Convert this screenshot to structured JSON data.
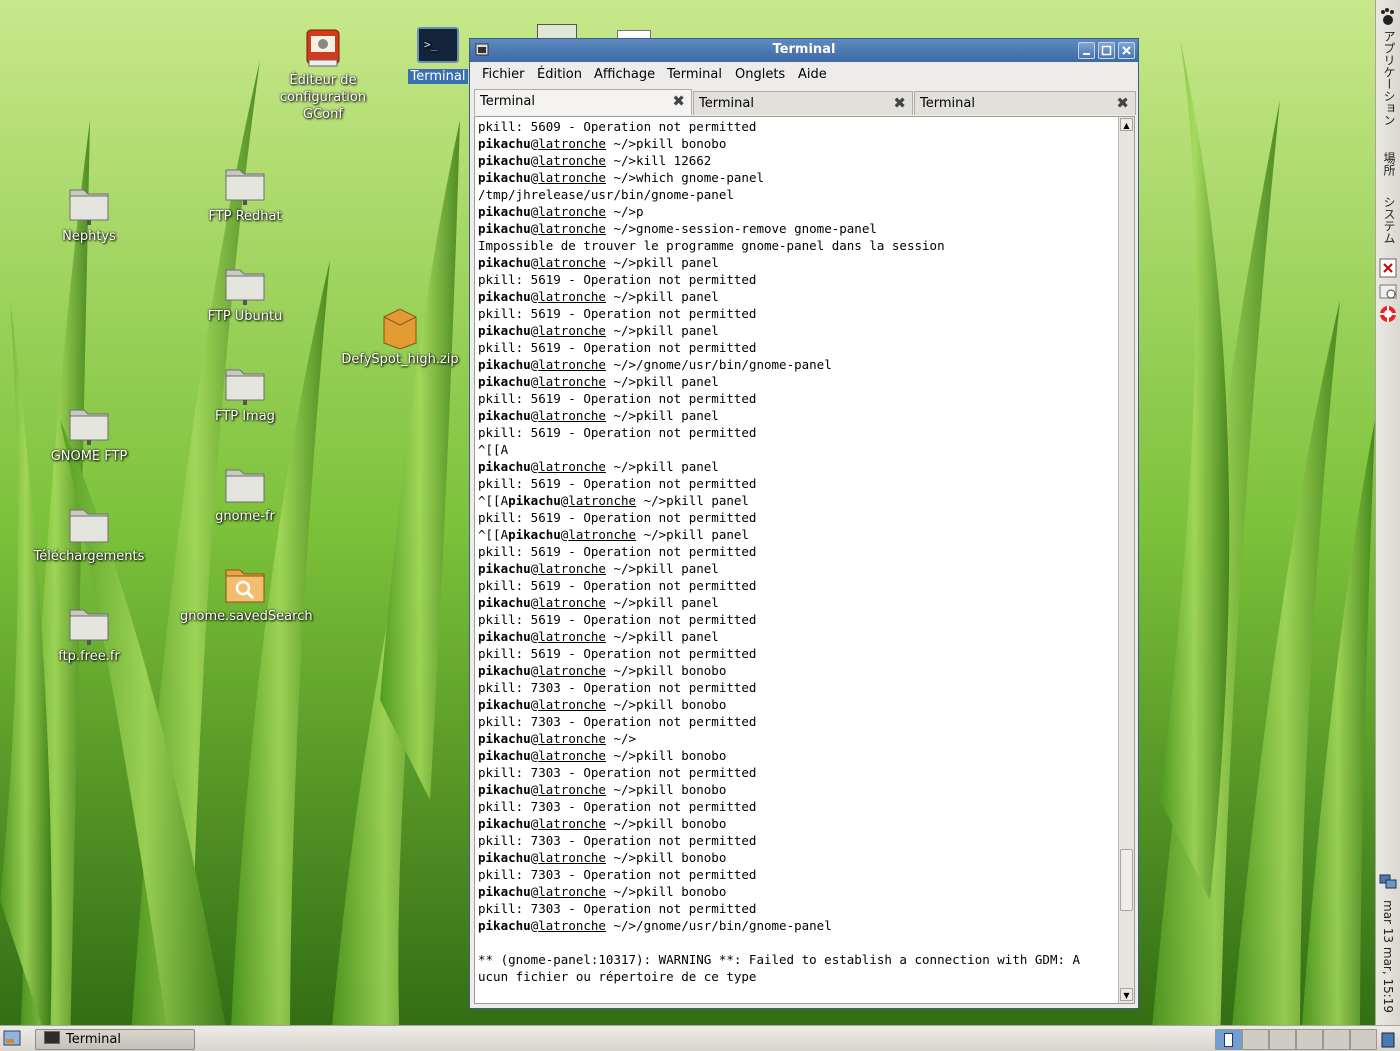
{
  "desktop": {
    "icons": [
      {
        "label": "Éditeur de configuration GConf",
        "line1": "Éditeur de",
        "line2": "configuration GConf"
      },
      {
        "label": "Terminal"
      },
      {
        "label": "Nephtys"
      },
      {
        "label": "FTP Redhat"
      },
      {
        "label": "FTP Ubuntu"
      },
      {
        "label": "DefySpot_high.zip"
      },
      {
        "label": "FTP Imag"
      },
      {
        "label": "GNOME FTP"
      },
      {
        "label": "gnome-fr"
      },
      {
        "label": "Téléchargements"
      },
      {
        "label": "gnome.savedSearch"
      },
      {
        "label": "ftp.free.fr"
      }
    ]
  },
  "right_panel": {
    "menu_applications": "アプリケーション",
    "menu_places": "場所",
    "menu_system": "システム",
    "clock": "mar 13 mar, 15:19"
  },
  "bottom_panel": {
    "task_label": "Terminal"
  },
  "window": {
    "title": "Terminal",
    "menus": [
      "Fichier",
      "Édition",
      "Affichage",
      "Terminal",
      "Onglets",
      "Aide"
    ],
    "tabs": [
      "Terminal",
      "Terminal",
      "Terminal"
    ],
    "prompt_user": "pikachu",
    "prompt_at": "@",
    "prompt_host": "latronche",
    "lines": [
      {
        "t": "o",
        "text": "pkill: 5609 - Operation not permitted"
      },
      {
        "t": "p",
        "cmd": " ~/>pkill bonobo"
      },
      {
        "t": "p",
        "cmd": " ~/>kill 12662"
      },
      {
        "t": "p",
        "cmd": " ~/>which gnome-panel"
      },
      {
        "t": "o",
        "text": "/tmp/jhrelease/usr/bin/gnome-panel"
      },
      {
        "t": "p",
        "cmd": " ~/>p"
      },
      {
        "t": "p",
        "cmd": " ~/>gnome-session-remove gnome-panel"
      },
      {
        "t": "o",
        "text": "Impossible de trouver le programme gnome-panel dans la session"
      },
      {
        "t": "p",
        "cmd": " ~/>pkill panel"
      },
      {
        "t": "o",
        "text": "pkill: 5619 - Operation not permitted"
      },
      {
        "t": "p",
        "cmd": " ~/>pkill panel"
      },
      {
        "t": "o",
        "text": "pkill: 5619 - Operation not permitted"
      },
      {
        "t": "p",
        "cmd": " ~/>pkill panel"
      },
      {
        "t": "o",
        "text": "pkill: 5619 - Operation not permitted"
      },
      {
        "t": "p",
        "cmd": " ~/>/gnome/usr/bin/gnome-panel"
      },
      {
        "t": "p",
        "cmd": " ~/>pkill panel"
      },
      {
        "t": "o",
        "text": "pkill: 5619 - Operation not permitted"
      },
      {
        "t": "p",
        "cmd": " ~/>pkill panel"
      },
      {
        "t": "o",
        "text": "pkill: 5619 - Operation not permitted"
      },
      {
        "t": "o",
        "text": "^[[A"
      },
      {
        "t": "p",
        "cmd": " ~/>pkill panel"
      },
      {
        "t": "o",
        "text": "pkill: 5619 - Operation not permitted"
      },
      {
        "t": "e",
        "pre": "^[[A",
        "cmd": " ~/>pkill panel"
      },
      {
        "t": "o",
        "text": "pkill: 5619 - Operation not permitted"
      },
      {
        "t": "e",
        "pre": "^[[A",
        "cmd": " ~/>pkill panel"
      },
      {
        "t": "o",
        "text": "pkill: 5619 - Operation not permitted"
      },
      {
        "t": "p",
        "cmd": " ~/>pkill panel"
      },
      {
        "t": "o",
        "text": "pkill: 5619 - Operation not permitted"
      },
      {
        "t": "p",
        "cmd": " ~/>pkill panel"
      },
      {
        "t": "o",
        "text": "pkill: 5619 - Operation not permitted"
      },
      {
        "t": "p",
        "cmd": " ~/>pkill panel"
      },
      {
        "t": "o",
        "text": "pkill: 5619 - Operation not permitted"
      },
      {
        "t": "p",
        "cmd": " ~/>pkill bonobo"
      },
      {
        "t": "o",
        "text": "pkill: 7303 - Operation not permitted"
      },
      {
        "t": "p",
        "cmd": " ~/>pkill bonobo"
      },
      {
        "t": "o",
        "text": "pkill: 7303 - Operation not permitted"
      },
      {
        "t": "p",
        "cmd": " ~/>"
      },
      {
        "t": "p",
        "cmd": " ~/>pkill bonobo"
      },
      {
        "t": "o",
        "text": "pkill: 7303 - Operation not permitted"
      },
      {
        "t": "p",
        "cmd": " ~/>pkill bonobo"
      },
      {
        "t": "o",
        "text": "pkill: 7303 - Operation not permitted"
      },
      {
        "t": "p",
        "cmd": " ~/>pkill bonobo"
      },
      {
        "t": "o",
        "text": "pkill: 7303 - Operation not permitted"
      },
      {
        "t": "p",
        "cmd": " ~/>pkill bonobo"
      },
      {
        "t": "o",
        "text": "pkill: 7303 - Operation not permitted"
      },
      {
        "t": "p",
        "cmd": " ~/>pkill bonobo"
      },
      {
        "t": "o",
        "text": "pkill: 7303 - Operation not permitted"
      },
      {
        "t": "p",
        "cmd": " ~/>/gnome/usr/bin/gnome-panel"
      },
      {
        "t": "o",
        "text": ""
      },
      {
        "t": "o",
        "text": "** (gnome-panel:10317): WARNING **: Failed to establish a connection with GDM: A"
      },
      {
        "t": "o",
        "text": "ucun fichier ou répertoire de ce type"
      }
    ]
  },
  "colors": {
    "titlebar": "#3d6aa5",
    "selection": "#3a6fb0"
  }
}
